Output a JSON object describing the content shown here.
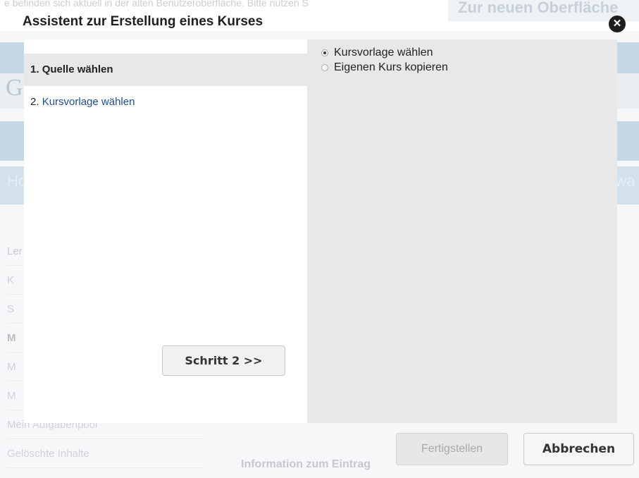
{
  "background": {
    "notice_text": "e befinden sich aktuell in der alten Benutzeroberfläche. Bitte nutzen S",
    "switch_button": "Zur neuen Oberfläche",
    "logo_fragment": "G",
    "nav_left_fragment": "Ho",
    "nav_right_fragment": "rwa",
    "sidebar": {
      "header": "Ler",
      "items": [
        "K",
        "S",
        "M",
        "M",
        "M",
        "Mein Aufgabenpool",
        "Gelöschte Inhalte"
      ]
    },
    "info_heading": "Information zum Eintrag"
  },
  "dialog": {
    "title": "Assistent zur Erstellung eines Kurses",
    "close_icon": "close-circle-icon",
    "steps": [
      {
        "num": "1.",
        "label": "Quelle wählen",
        "active": true
      },
      {
        "num": "2.",
        "label": "Kursvorlage wählen",
        "active": false
      }
    ],
    "next_button": "Schritt 2 >>",
    "options": [
      {
        "label": "Kursvorlage wählen",
        "checked": true
      },
      {
        "label": "Eigenen Kurs kopieren",
        "checked": false
      }
    ],
    "finish_button": "Fertigstellen",
    "cancel_button": "Abbrechen"
  }
}
